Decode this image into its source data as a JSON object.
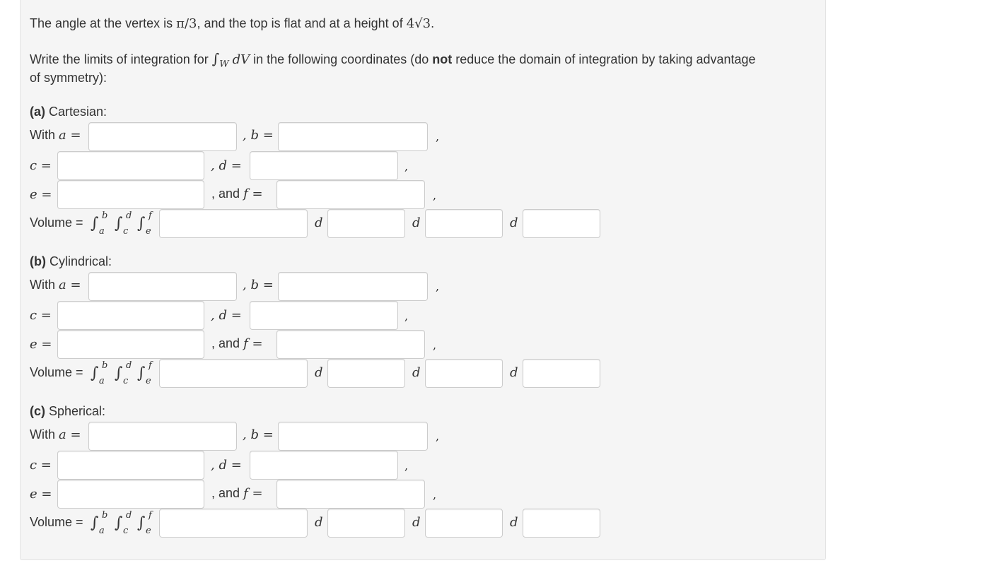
{
  "problem": {
    "line1_pre": "The angle at the vertex is ",
    "line1_angle": "π/3",
    "line1_mid": ", and the top is flat and at a height of ",
    "line1_height": "4√3",
    "line1_end": ".",
    "line2_pre": "Write the limits of integration for ",
    "integral_sub": "W",
    "integrand": "dV",
    "line2_mid": " in the following coordinates (do ",
    "line2_bold": "not",
    "line2_post": " reduce the domain of integration by taking advantage",
    "line3": "of symmetry):"
  },
  "labels": {
    "with": "With",
    "a_eq": "a =",
    "comma_b_eq": ", b =",
    "c_eq": "c =",
    "comma_d_eq": ", d =",
    "e_eq": "e =",
    "comma_and": ", and",
    "f_eq": "f =",
    "trailing_comma": ",",
    "volume": "Volume =",
    "int_b": "b",
    "int_a": "a",
    "int_d": "d",
    "int_c": "c",
    "int_f": "f",
    "int_e": "e",
    "integral": "∫",
    "diff": "d"
  },
  "sections": [
    {
      "letter": "(a)",
      "name": "Cartesian:"
    },
    {
      "letter": "(b)",
      "name": "Cylindrical:"
    },
    {
      "letter": "(c)",
      "name": "Spherical:"
    }
  ],
  "inputs": {
    "a": "",
    "b": "",
    "c": "",
    "d": "",
    "e": "",
    "f": "",
    "integrand": "",
    "d1": "",
    "d2": "",
    "d3": ""
  }
}
